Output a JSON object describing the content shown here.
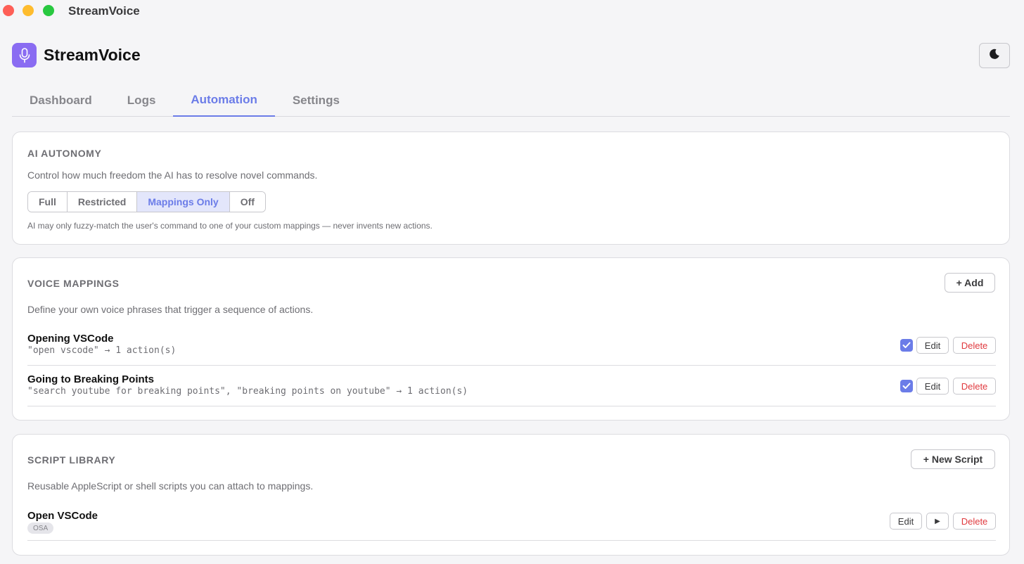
{
  "window": {
    "title": "StreamVoice"
  },
  "app": {
    "name": "StreamVoice",
    "logo_icon": "microphone-icon",
    "theme_icon": "moon-icon",
    "accent": "#6b7ce8",
    "logo_color": "#8a6cf2",
    "danger": "#e0393e"
  },
  "tabs": [
    {
      "label": "Dashboard"
    },
    {
      "label": "Logs"
    },
    {
      "label": "Automation"
    },
    {
      "label": "Settings"
    }
  ],
  "ai_autonomy": {
    "title": "AI AUTONOMY",
    "description": "Control how much freedom the AI has to resolve novel commands.",
    "options": [
      {
        "label": "Full"
      },
      {
        "label": "Restricted"
      },
      {
        "label": "Mappings Only"
      },
      {
        "label": "Off"
      }
    ],
    "selected": "Mappings Only",
    "hint": "AI may only fuzzy-match the user's command to one of your custom mappings — never invents new actions."
  },
  "voice_mappings": {
    "title": "VOICE MAPPINGS",
    "add_label": "+ Add",
    "description": "Define your own voice phrases that trigger a sequence of actions.",
    "items": [
      {
        "name": "Opening VSCode",
        "detail": "\"open vscode\" → 1 action(s)",
        "enabled": true,
        "edit_label": "Edit",
        "delete_label": "Delete"
      },
      {
        "name": "Going to Breaking Points",
        "detail": "\"search youtube for breaking points\", \"breaking points on youtube\" → 1 action(s)",
        "enabled": true,
        "edit_label": "Edit",
        "delete_label": "Delete"
      }
    ]
  },
  "script_library": {
    "title": "SCRIPT LIBRARY",
    "new_label": "+ New Script",
    "description": "Reusable AppleScript or shell scripts you can attach to mappings.",
    "items": [
      {
        "name": "Open VSCode",
        "badge": "OSA",
        "edit_label": "Edit",
        "run_label": "▶",
        "delete_label": "Delete"
      }
    ]
  }
}
